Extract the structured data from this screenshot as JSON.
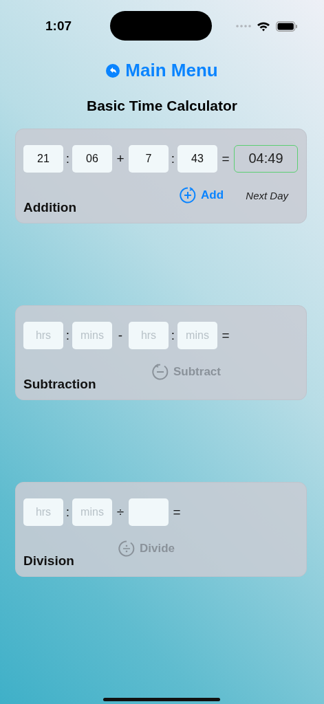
{
  "status_bar": {
    "time": "1:07"
  },
  "back_link": {
    "label": "Main Menu"
  },
  "title": "Basic Time Calculator",
  "cards": [
    {
      "label": "Addition",
      "items": [
        {
          "kind": "field",
          "value": "21"
        },
        {
          "kind": "symbol",
          "text": ":"
        },
        {
          "kind": "field",
          "value": "06"
        },
        {
          "kind": "symbol",
          "text": "+"
        },
        {
          "kind": "field",
          "value": "7"
        },
        {
          "kind": "symbol",
          "text": ":"
        },
        {
          "kind": "field",
          "value": "43"
        },
        {
          "kind": "symbol",
          "text": "="
        },
        {
          "kind": "result",
          "value": "04:49"
        }
      ],
      "button": {
        "label": "Add",
        "kind": "plus",
        "disabled": false
      },
      "note": "Next Day"
    },
    {
      "label": "Subtraction",
      "items": [
        {
          "kind": "field",
          "placeholder": "hrs"
        },
        {
          "kind": "symbol",
          "text": ":"
        },
        {
          "kind": "field",
          "placeholder": "mins"
        },
        {
          "kind": "symbol",
          "text": "-"
        },
        {
          "kind": "field",
          "placeholder": "hrs"
        },
        {
          "kind": "symbol",
          "text": ":"
        },
        {
          "kind": "field",
          "placeholder": "mins"
        },
        {
          "kind": "symbol",
          "text": "="
        }
      ],
      "button": {
        "label": "Subtract",
        "kind": "minus",
        "disabled": true
      }
    },
    {
      "label": "Division",
      "items": [
        {
          "kind": "field",
          "placeholder": "hrs"
        },
        {
          "kind": "symbol",
          "text": ":"
        },
        {
          "kind": "field",
          "placeholder": "mins"
        },
        {
          "kind": "symbol",
          "text": "÷"
        },
        {
          "kind": "field"
        },
        {
          "kind": "symbol",
          "text": "="
        }
      ],
      "button": {
        "label": "Divide",
        "kind": "divide",
        "disabled": true
      }
    }
  ]
}
